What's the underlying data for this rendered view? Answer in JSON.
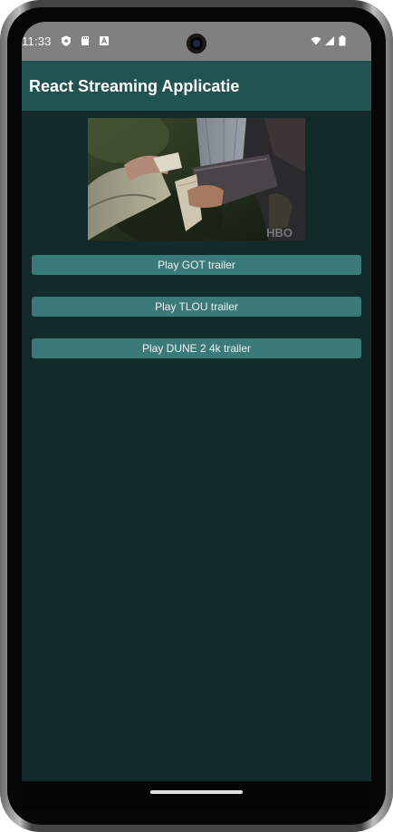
{
  "status_bar": {
    "time": "11:33",
    "left_icons": [
      "shield-icon",
      "sd-card-icon",
      "font-a-icon"
    ],
    "right_icons": [
      "wifi-icon",
      "cell-signal-icon",
      "battery-icon"
    ]
  },
  "app_bar": {
    "title": "React Streaming Applicatie",
    "color": "#215352"
  },
  "content": {
    "background": "#122b2a",
    "video": {
      "watermark": "HBO"
    },
    "buttons": [
      {
        "label": "Play GOT trailer"
      },
      {
        "label": "Play TLOU trailer"
      },
      {
        "label": "Play DUNE 2 4k trailer"
      }
    ],
    "button_color": "#3a7a78"
  }
}
